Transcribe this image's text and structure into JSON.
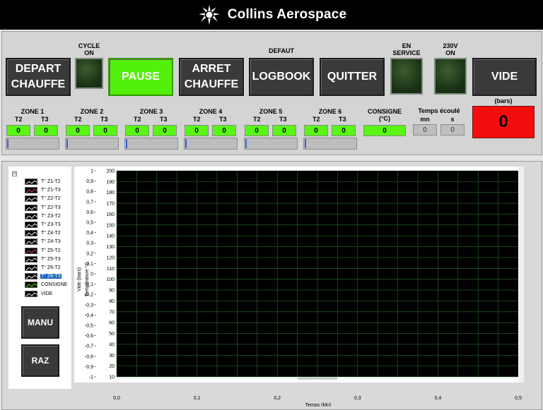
{
  "header": {
    "brand": "Collins Aerospace"
  },
  "buttons": {
    "depart_chauffe": "DEPART\nCHAUFFE",
    "pause": "PAUSE",
    "arret_chauffe": "ARRET\nCHAUFFE",
    "logbook": "LOGBOOK",
    "quitter": "QUITTER",
    "vide": "VIDE",
    "manu": "MANU",
    "raz": "RAZ"
  },
  "indicators": {
    "cycle_on": "CYCLE\nON",
    "defaut": "DEFAUT",
    "en_service": "EN\nSERVICE",
    "v230_on": "230V\nON"
  },
  "zones": [
    {
      "label": "ZONE 1",
      "t2_label": "T2",
      "t3_label": "T3",
      "t2": "0",
      "t3": "0"
    },
    {
      "label": "ZONE 2",
      "t2_label": "T2",
      "t3_label": "T3",
      "t2": "0",
      "t3": "0"
    },
    {
      "label": "ZONE 3",
      "t2_label": "T2",
      "t3_label": "T3",
      "t2": "0",
      "t3": "0"
    },
    {
      "label": "ZONE 4",
      "t2_label": "T2",
      "t3_label": "T3",
      "t2": "0",
      "t3": "0"
    },
    {
      "label": "ZONE 5",
      "t2_label": "T2",
      "t3_label": "T3",
      "t2": "0",
      "t3": "0"
    },
    {
      "label": "ZONE 6",
      "t2_label": "T2",
      "t3_label": "T3",
      "t2": "0",
      "t3": "0"
    }
  ],
  "consigne": {
    "label": "CONSIGNE\n(°C)",
    "value": "0"
  },
  "temps": {
    "label": "Temps écoulé",
    "mn_label": "mn",
    "s_label": "s",
    "mn": "0",
    "s": "0"
  },
  "vide_display": {
    "unit_label": "(bars)",
    "value": "0"
  },
  "legend": {
    "tree_symbol": "⊟",
    "items": [
      "T° Z1-T2",
      "T° Z1-T3",
      "T° Z2-T2",
      "T° Z2-T3",
      "T° Z3-T2",
      "T° Z3-T3",
      "T° Z4-T2",
      "T° Z4-T3",
      "T° Z5-T2",
      "T° Z5-T3",
      "T° Z6-T2",
      "T° Z6-T3",
      "CONSIGNE",
      "VIDE"
    ],
    "selected_index": 11,
    "swatch_colors": [
      "#ffffff",
      "#e05050",
      "#ffffff",
      "#ffffff",
      "#ffffff",
      "#ffffff",
      "#ffffff",
      "#ffffff",
      "#e05050",
      "#ffffff",
      "#ffffff",
      "#ffffff",
      "#52f00a",
      "#ffffff"
    ]
  },
  "chart_data": {
    "type": "line",
    "xlabel": "Temps (Mn)",
    "ylabel_left": "Vide (bars)",
    "ylabel_right": "Température °C",
    "xlim": [
      0,
      0.5
    ],
    "x_ticks": [
      "0,0",
      "0,1",
      "0,2",
      "0,3",
      "0,4",
      "0,5"
    ],
    "y_left_lim": [
      -1,
      1
    ],
    "y_left_ticks": [
      "1",
      "0,9",
      "0,8",
      "0,7",
      "0,6",
      "0,5",
      "0,4",
      "0,3",
      "0,2",
      "0,1",
      "0",
      "-0,1",
      "-0,2",
      "-0,3",
      "-0,4",
      "-0,5",
      "-0,6",
      "-0,7",
      "-0,8",
      "-0,9",
      "-1"
    ],
    "y_right_lim": [
      10,
      200
    ],
    "y_right_ticks": [
      "200",
      "190",
      "180",
      "170",
      "160",
      "150",
      "140",
      "130",
      "120",
      "110",
      "100",
      "90",
      "80",
      "70",
      "60",
      "50",
      "40",
      "30",
      "20",
      "10"
    ],
    "grid": true,
    "background": "#000000",
    "grid_color": "#2d6b2d",
    "series": []
  },
  "colors": {
    "accent_green": "#52f00a",
    "alarm_red": "#f40d0d",
    "button_dark": "#3a3a3a"
  }
}
